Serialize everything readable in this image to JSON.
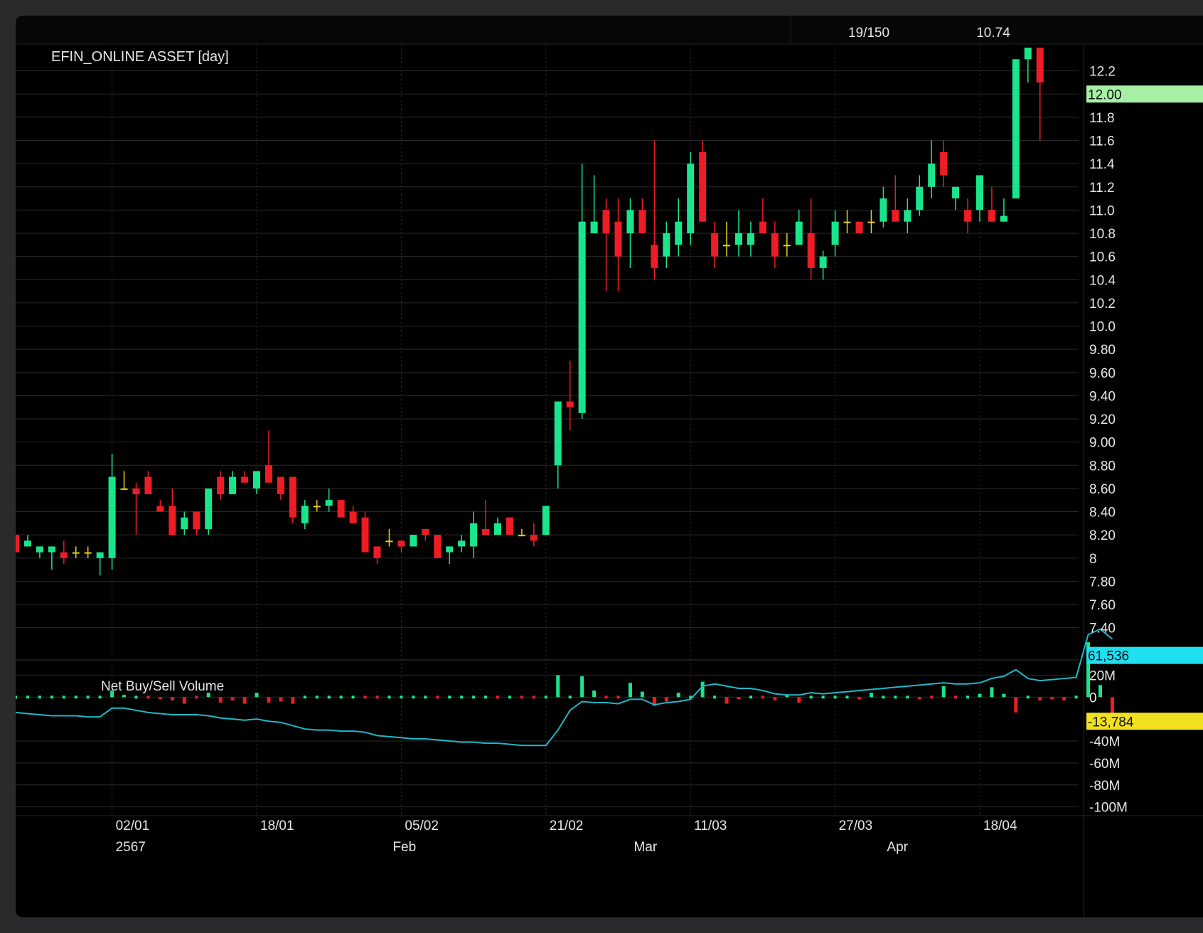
{
  "header": {
    "counter": "19/150",
    "price": "10.74"
  },
  "colors": {
    "background": "#000000",
    "grid": "#2a2a2a",
    "up": "#19e68c",
    "down": "#ee1c24",
    "doji": "#e8d21a",
    "line": "#1fb8c8",
    "price_tag": "#a6f0a6",
    "volume_tag": "#1fe0f0",
    "negative_tag": "#f0e020"
  },
  "chart_data": [
    {
      "type": "candlestick",
      "title": "EFIN_ONLINE ASSET [day]",
      "ylim": [
        7.22,
        12.4
      ],
      "y_ticks": [
        "12.2",
        "12.0",
        "11.8",
        "11.6",
        "11.4",
        "11.2",
        "11.0",
        "10.8",
        "10.6",
        "10.4",
        "10.2",
        "10.0",
        "9.80",
        "9.60",
        "9.40",
        "9.20",
        "9.00",
        "8.80",
        "8.60",
        "8.40",
        "8.20",
        "8",
        "7.80",
        "7.60",
        "7.40"
      ],
      "y_tick_values": [
        12.2,
        12.0,
        11.8,
        11.6,
        11.4,
        11.2,
        11.0,
        10.8,
        10.6,
        10.4,
        10.2,
        10.0,
        9.8,
        9.6,
        9.4,
        9.2,
        9.0,
        8.8,
        8.6,
        8.4,
        8.2,
        8.0,
        7.8,
        7.6,
        7.4
      ],
      "last_price_tag": "12.00",
      "last_price_value": 12.0,
      "x_tick_labels": [
        "02/01",
        "18/01",
        "05/02",
        "21/02",
        "11/03",
        "27/03",
        "18/04"
      ],
      "x_tick_index": [
        8,
        20,
        32,
        44,
        56,
        68,
        80
      ],
      "period_labels": [
        "2567",
        "Feb",
        "Mar",
        "Apr"
      ],
      "period_label_index": [
        8,
        31,
        51,
        72
      ],
      "candles": [
        [
          8.2,
          8.2,
          8.05,
          8.05
        ],
        [
          8.1,
          8.2,
          8.1,
          8.15
        ],
        [
          8.05,
          8.1,
          8.0,
          8.1
        ],
        [
          8.05,
          8.1,
          7.9,
          8.1
        ],
        [
          8.05,
          8.15,
          7.95,
          8.0
        ],
        [
          8.05,
          8.1,
          8.0,
          8.05
        ],
        [
          8.05,
          8.1,
          8.0,
          8.05
        ],
        [
          8.0,
          8.05,
          7.85,
          8.05
        ],
        [
          8.0,
          8.9,
          7.9,
          8.7
        ],
        [
          8.6,
          8.75,
          8.6,
          8.6
        ],
        [
          8.6,
          8.65,
          8.2,
          8.55
        ],
        [
          8.7,
          8.75,
          8.55,
          8.55
        ],
        [
          8.45,
          8.5,
          8.4,
          8.4
        ],
        [
          8.45,
          8.6,
          8.2,
          8.2
        ],
        [
          8.25,
          8.4,
          8.2,
          8.35
        ],
        [
          8.4,
          8.4,
          8.2,
          8.25
        ],
        [
          8.25,
          8.6,
          8.2,
          8.6
        ],
        [
          8.7,
          8.75,
          8.5,
          8.55
        ],
        [
          8.55,
          8.75,
          8.55,
          8.7
        ],
        [
          8.7,
          8.75,
          8.65,
          8.65
        ],
        [
          8.6,
          8.75,
          8.55,
          8.75
        ],
        [
          8.8,
          9.1,
          8.65,
          8.65
        ],
        [
          8.7,
          8.7,
          8.5,
          8.55
        ],
        [
          8.7,
          8.7,
          8.3,
          8.35
        ],
        [
          8.3,
          8.5,
          8.25,
          8.45
        ],
        [
          8.45,
          8.5,
          8.4,
          8.45
        ],
        [
          8.45,
          8.6,
          8.4,
          8.5
        ],
        [
          8.5,
          8.5,
          8.35,
          8.35
        ],
        [
          8.4,
          8.45,
          8.3,
          8.3
        ],
        [
          8.35,
          8.4,
          8.15,
          8.05
        ],
        [
          8.1,
          8.1,
          7.95,
          8.0
        ],
        [
          8.15,
          8.25,
          8.1,
          8.15
        ],
        [
          8.15,
          8.15,
          8.05,
          8.1
        ],
        [
          8.1,
          8.2,
          8.1,
          8.2
        ],
        [
          8.25,
          8.25,
          8.15,
          8.2
        ],
        [
          8.2,
          8.2,
          8.0,
          8.0
        ],
        [
          8.05,
          8.1,
          7.95,
          8.1
        ],
        [
          8.1,
          8.2,
          8.05,
          8.15
        ],
        [
          8.1,
          8.4,
          8.0,
          8.3
        ],
        [
          8.25,
          8.5,
          8.2,
          8.2
        ],
        [
          8.2,
          8.35,
          8.2,
          8.3
        ],
        [
          8.35,
          8.35,
          8.2,
          8.2
        ],
        [
          8.2,
          8.25,
          8.2,
          8.2
        ],
        [
          8.2,
          8.3,
          8.1,
          8.15
        ],
        [
          8.2,
          8.45,
          8.2,
          8.45
        ],
        [
          8.8,
          9.35,
          8.6,
          9.35
        ],
        [
          9.35,
          9.7,
          9.1,
          9.3
        ],
        [
          9.25,
          11.4,
          9.2,
          10.9
        ],
        [
          10.8,
          11.3,
          10.8,
          10.9
        ],
        [
          11.0,
          11.1,
          10.3,
          10.8
        ],
        [
          10.9,
          11.1,
          10.3,
          10.6
        ],
        [
          10.8,
          11.1,
          10.5,
          11.0
        ],
        [
          11.0,
          11.1,
          10.8,
          10.8
        ],
        [
          10.7,
          11.6,
          10.4,
          10.5
        ],
        [
          10.6,
          10.9,
          10.5,
          10.8
        ],
        [
          10.7,
          11.1,
          10.6,
          10.9
        ],
        [
          10.8,
          11.5,
          10.7,
          11.4
        ],
        [
          11.5,
          11.6,
          10.9,
          10.9
        ],
        [
          10.8,
          10.9,
          10.5,
          10.6
        ],
        [
          10.7,
          10.9,
          10.6,
          10.7
        ],
        [
          10.7,
          11.0,
          10.6,
          10.8
        ],
        [
          10.7,
          10.9,
          10.6,
          10.8
        ],
        [
          10.9,
          11.1,
          10.8,
          10.8
        ],
        [
          10.8,
          10.9,
          10.5,
          10.6
        ],
        [
          10.7,
          10.8,
          10.6,
          10.7
        ],
        [
          10.7,
          11.0,
          10.7,
          10.9
        ],
        [
          10.8,
          11.1,
          10.4,
          10.5
        ],
        [
          10.5,
          10.65,
          10.4,
          10.6
        ],
        [
          10.7,
          11.0,
          10.6,
          10.9
        ],
        [
          10.9,
          11.0,
          10.8,
          10.9
        ],
        [
          10.9,
          10.9,
          10.8,
          10.8
        ],
        [
          10.9,
          11.0,
          10.8,
          10.9
        ],
        [
          10.9,
          11.2,
          10.85,
          11.1
        ],
        [
          11.0,
          11.3,
          10.9,
          10.9
        ],
        [
          10.9,
          11.1,
          10.8,
          11.0
        ],
        [
          11.0,
          11.3,
          10.95,
          11.2
        ],
        [
          11.2,
          11.6,
          11.1,
          11.4
        ],
        [
          11.5,
          11.6,
          11.2,
          11.3
        ],
        [
          11.1,
          11.2,
          11.0,
          11.2
        ],
        [
          11.0,
          11.1,
          10.8,
          10.9
        ],
        [
          11.0,
          11.3,
          10.9,
          11.3
        ],
        [
          11.0,
          11.2,
          10.9,
          10.9
        ],
        [
          10.9,
          11.1,
          10.9,
          10.95
        ],
        [
          11.1,
          12.3,
          11.1,
          12.3
        ],
        [
          12.3,
          12.4,
          12.1,
          12.4
        ],
        [
          12.4,
          12.4,
          11.6,
          12.1
        ]
      ]
    },
    {
      "type": "bar+line",
      "title": "Net Buy/Sell Volume",
      "ylim": [
        -108,
        30
      ],
      "y_ticks": [
        "20M",
        "0",
        "-40M",
        "-60M",
        "-80M",
        "-100M"
      ],
      "y_tick_values": [
        20,
        0,
        -40,
        -60,
        -80,
        -100
      ],
      "tags": [
        "61,536",
        "-13,784"
      ],
      "tag_values": [
        38,
        -22
      ],
      "bars": [
        0,
        0,
        0,
        0,
        0,
        0,
        0,
        0,
        6,
        2,
        0,
        -1,
        -2,
        -3,
        -6,
        -1,
        4,
        -5,
        -3,
        -6,
        4,
        -5,
        -4,
        -6,
        0,
        1,
        0,
        0,
        0,
        -1,
        -1,
        0,
        0,
        0,
        0,
        -1,
        1,
        0,
        0,
        0,
        -1,
        0,
        -1,
        -1,
        0,
        20,
        1,
        19,
        6,
        -1,
        -1,
        13,
        5,
        -8,
        -4,
        4,
        0,
        14,
        0,
        -6,
        -2,
        0,
        -1,
        -3,
        2,
        -5,
        1,
        1,
        0,
        1,
        -2,
        4,
        0,
        0,
        0,
        -2,
        -1,
        10,
        -1,
        1,
        3,
        9,
        3,
        -14,
        0,
        -3,
        -2,
        -3,
        0,
        50,
        11,
        -16
      ],
      "line": [
        -14,
        -15,
        -16,
        -17,
        -17,
        -17,
        -18,
        -18,
        -10,
        -10,
        -12,
        -14,
        -15,
        -16,
        -16,
        -16,
        -17,
        -19,
        -20,
        -21,
        -20,
        -22,
        -23,
        -26,
        -29,
        -30,
        -30,
        -31,
        -31,
        -32,
        -35,
        -36,
        -37,
        -38,
        -38,
        -39,
        -40,
        -41,
        -41,
        -42,
        -42,
        -43,
        -44,
        -44,
        -44,
        -30,
        -12,
        -4,
        -5,
        -5,
        -6,
        -2,
        -2,
        -7,
        -5,
        -4,
        -2,
        10,
        12,
        10,
        8,
        8,
        6,
        3,
        2,
        2,
        4,
        3,
        4,
        5,
        6,
        7,
        8,
        9,
        10,
        11,
        12,
        13,
        12,
        12,
        13,
        17,
        19,
        25,
        17,
        15,
        16,
        17,
        18,
        57,
        62,
        53
      ]
    }
  ]
}
